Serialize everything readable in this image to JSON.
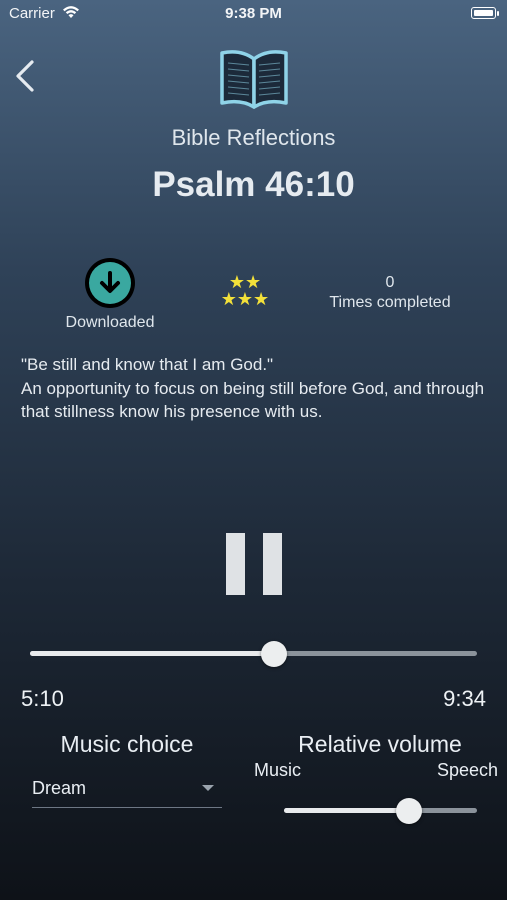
{
  "status_bar": {
    "carrier": "Carrier",
    "time": "9:38 PM"
  },
  "header": {
    "category": "Bible Reflections",
    "title": "Psalm 46:10"
  },
  "stats": {
    "download_label": "Downloaded",
    "stars_top": "★★",
    "stars_bottom": "★★★",
    "rating_stars": 5,
    "times_completed": "0",
    "times_completed_label": "Times completed"
  },
  "description": "\"Be still and know that I am God.\"\nAn opportunity to focus on being still before God, and through that stillness know his presence with us.",
  "player": {
    "elapsed": "5:10",
    "duration": "9:34",
    "progress_fraction": 0.545
  },
  "music": {
    "heading": "Music choice",
    "selected": "Dream"
  },
  "volume": {
    "heading": "Relative volume",
    "left_label": "Music",
    "right_label": "Speech",
    "balance_fraction": 0.65
  },
  "icons": {
    "back": "chevron-left-icon",
    "book": "open-book-icon",
    "download": "download-arrow-icon",
    "pause": "pause-icon"
  },
  "colors": {
    "accent_teal": "#3aa8a0",
    "star_yellow": "#f3e13a"
  }
}
